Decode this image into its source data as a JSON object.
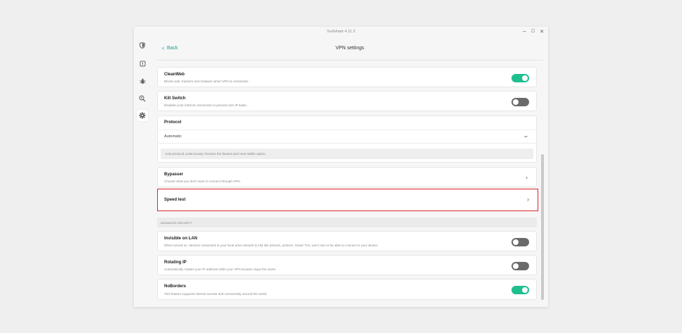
{
  "window": {
    "title": "Surfshark 4.11.3",
    "controls": {
      "minimize": "–",
      "maximize": "☐",
      "close": "✕"
    }
  },
  "rail": {
    "icons": [
      "shield-icon",
      "alert-icon",
      "bug-icon",
      "search-person-icon",
      "settings-icon"
    ],
    "active": "settings-icon"
  },
  "header": {
    "back_label": "Back",
    "title": "VPN settings"
  },
  "settings": {
    "cleanweb": {
      "title": "CleanWeb",
      "desc": "Blocks ads, trackers and malware when VPN is connected.",
      "enabled": true
    },
    "killswitch": {
      "title": "Kill Switch",
      "desc": "Disables your internet connection to prevent rare IP leaks...",
      "enabled": false
    },
    "protocol": {
      "title": "Protocol",
      "value": "Automatic",
      "note": "Auto-protocol continuously chooses the fastest and most stable option."
    },
    "bypasser": {
      "title": "Bypasser",
      "desc": "Choose what you don't want to connect through VPN."
    },
    "speedtest": {
      "title": "Speed test"
    }
  },
  "advanced": {
    "heading": "ADVANCED SECURITY",
    "invisible": {
      "title": "Invisible on LAN",
      "desc": "When turned on, devices connected to your local area network (LAN) like phones, printers, Smart TVs, won't see or be able to connect to your device.",
      "enabled": false
    },
    "rotating": {
      "title": "Rotating IP",
      "desc": "Automatically rotates your IP address while your VPN location stays the same.",
      "enabled": false
    },
    "noborders": {
      "title": "NoBorders",
      "desc": "This feature supports internet access and connectivity around the world.",
      "enabled": true
    }
  },
  "colors": {
    "accent": "#1fbe8f",
    "link": "#1f9e8c",
    "highlight": "#e0262c",
    "toggle_off": "#6a6a6a"
  }
}
